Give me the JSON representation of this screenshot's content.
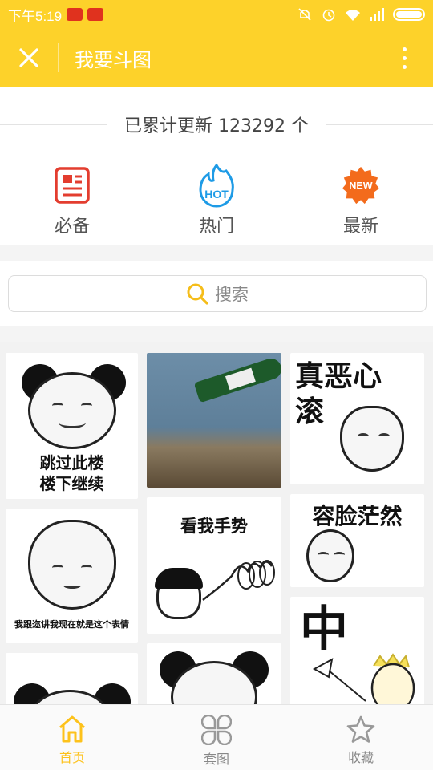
{
  "status_bar": {
    "time": "下午5:19"
  },
  "app_bar": {
    "title": "我要斗图"
  },
  "banner": {
    "count_text": "已累计更新 123292 个",
    "categories": [
      {
        "label": "必备",
        "icon": "document-icon",
        "color": "#e33d2f"
      },
      {
        "label": "热门",
        "icon": "hot-flame-icon",
        "color": "#1e9be6"
      },
      {
        "label": "最新",
        "icon": "new-badge-icon",
        "color": "#f36b1c"
      }
    ]
  },
  "search": {
    "placeholder": "搜索"
  },
  "memes": [
    {
      "caption": "跳过此楼\n楼下继续"
    },
    {
      "caption": ""
    },
    {
      "caption": "真恶心\n滚"
    },
    {
      "caption": "容脸茫然"
    },
    {
      "caption": "我跟迩讲我现在就是这个表情"
    },
    {
      "caption": "看我手势"
    },
    {
      "caption": "中"
    },
    {
      "caption": ""
    },
    {
      "caption": ""
    }
  ],
  "tab_bar": {
    "items": [
      {
        "label": "首页",
        "icon": "home-icon",
        "active": true
      },
      {
        "label": "套图",
        "icon": "grid-icon",
        "active": false
      },
      {
        "label": "收藏",
        "icon": "star-icon",
        "active": false
      }
    ]
  },
  "colors": {
    "accent": "#fdd22a",
    "tab_active": "#fdc21b"
  }
}
